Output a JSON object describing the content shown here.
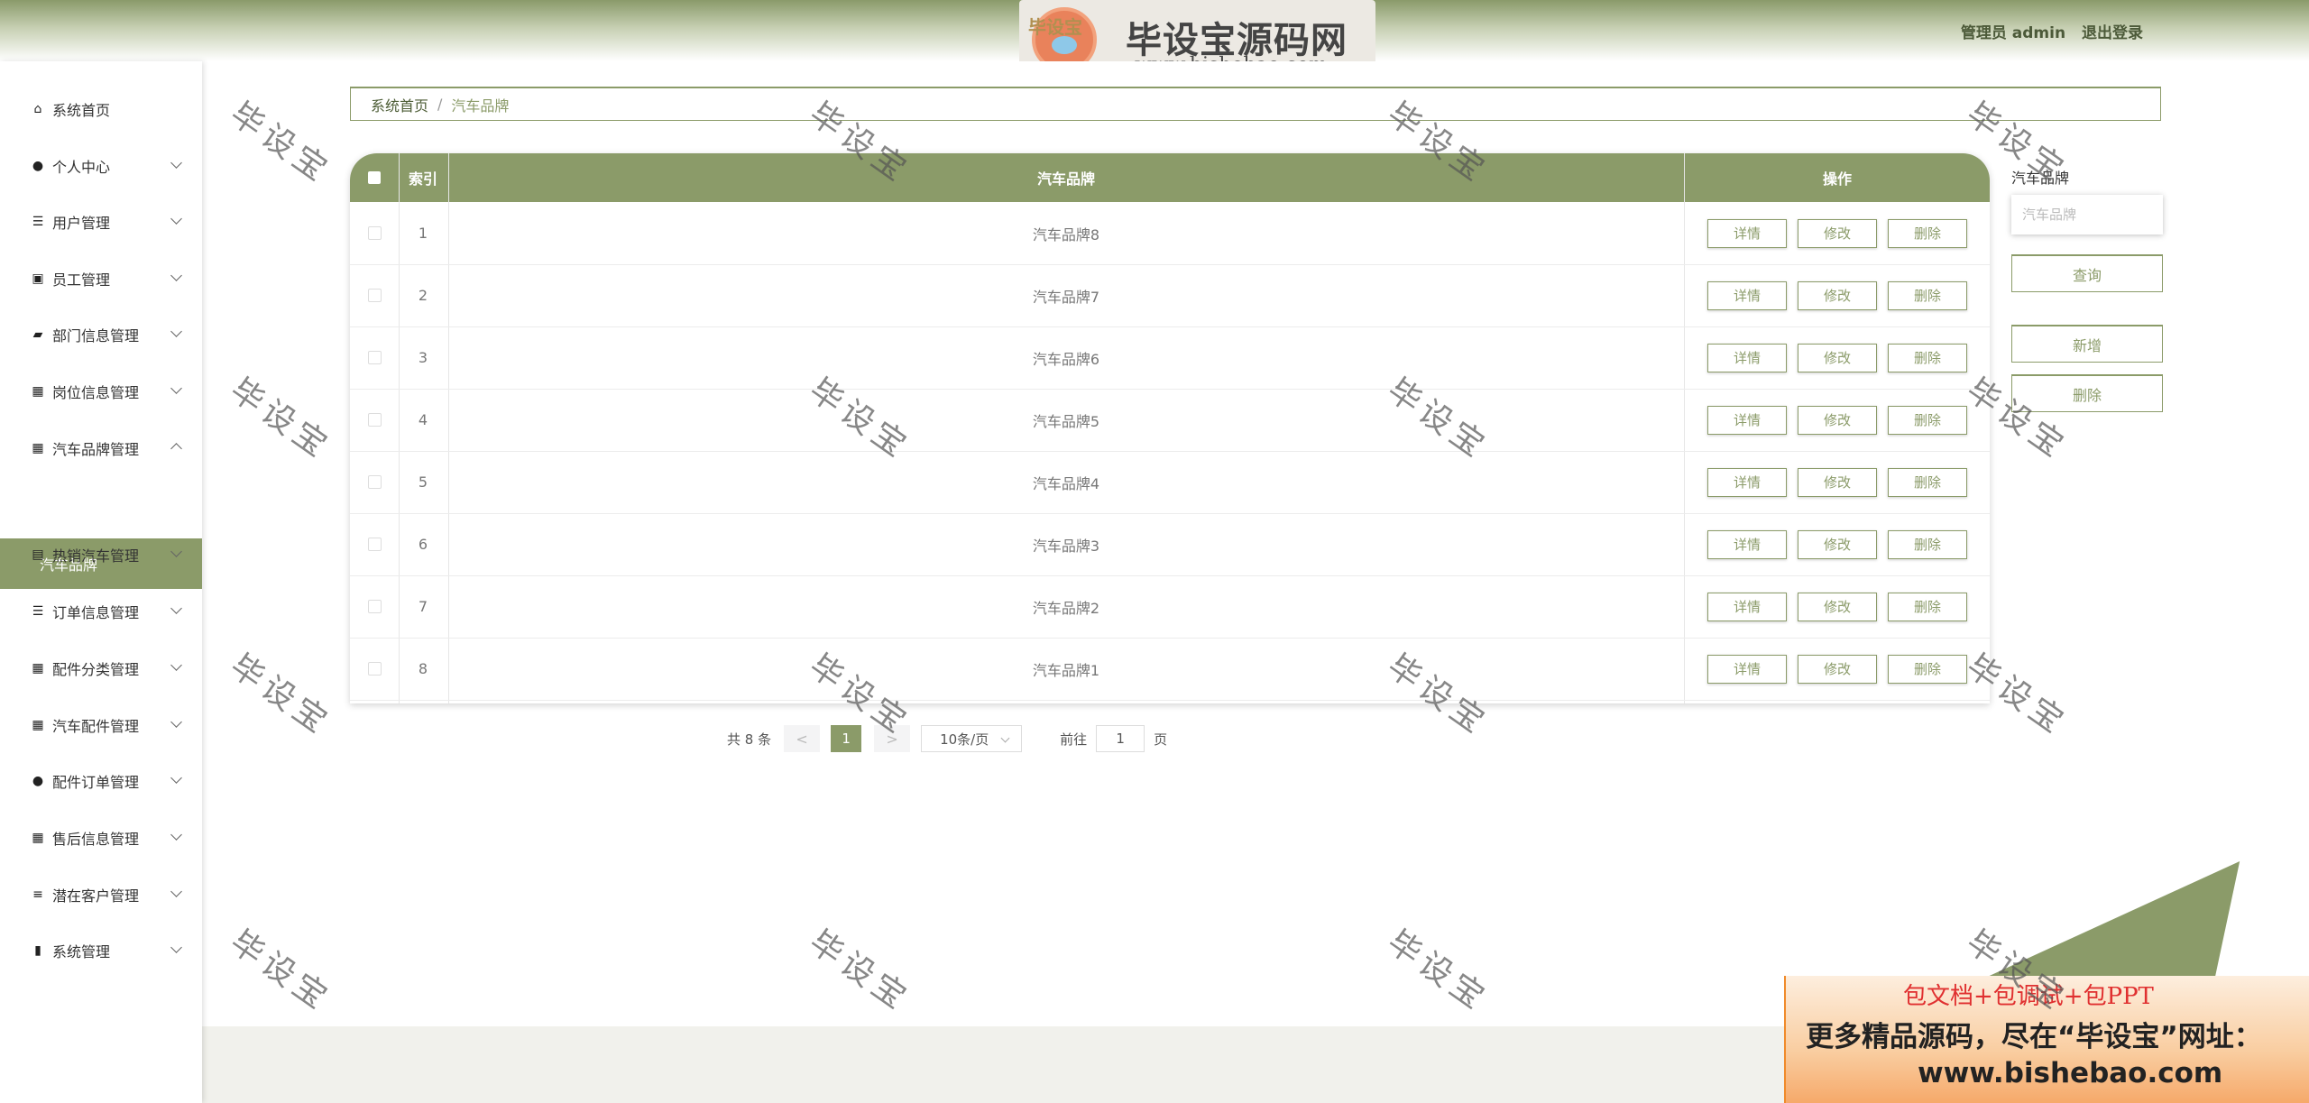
{
  "header": {
    "logo_overlay_text": "毕设宝",
    "logo_title": "毕设宝源码网",
    "logo_url": "www.bishebao.com",
    "user_label": "管理员 admin",
    "logout_label": "退出登录"
  },
  "sidebar": {
    "items": [
      {
        "label": "系统首页",
        "icon": "home-icon",
        "glyph": "⌂"
      },
      {
        "label": "个人中心",
        "icon": "user-icon",
        "glyph": "●"
      },
      {
        "label": "用户管理",
        "icon": "list-icon",
        "glyph": "☰"
      },
      {
        "label": "员工管理",
        "icon": "chart-icon",
        "glyph": "▣"
      },
      {
        "label": "部门信息管理",
        "icon": "ticket-icon",
        "glyph": "▰"
      },
      {
        "label": "岗位信息管理",
        "icon": "grid-icon",
        "glyph": "▦"
      },
      {
        "label": "汽车品牌管理",
        "icon": "grid-icon",
        "glyph": "▦"
      },
      {
        "label": "热销汽车管理",
        "icon": "message-icon",
        "glyph": "▤"
      },
      {
        "label": "订单信息管理",
        "icon": "list-icon",
        "glyph": "☰"
      },
      {
        "label": "配件分类管理",
        "icon": "grid-icon",
        "glyph": "▦"
      },
      {
        "label": "汽车配件管理",
        "icon": "grid-icon",
        "glyph": "▦"
      },
      {
        "label": "配件订单管理",
        "icon": "location-icon",
        "glyph": "●"
      },
      {
        "label": "售后信息管理",
        "icon": "grid-icon",
        "glyph": "▦"
      },
      {
        "label": "潜在客户管理",
        "icon": "sliders-icon",
        "glyph": "≡"
      },
      {
        "label": "系统管理",
        "icon": "settings-icon",
        "glyph": "▮"
      }
    ],
    "active_sub": "汽车品牌"
  },
  "breadcrumb": {
    "home": "系统首页",
    "separator": "/",
    "current": "汽车品牌"
  },
  "table": {
    "headers": {
      "index": "索引",
      "brand": "汽车品牌",
      "actions": "操作"
    },
    "rows": [
      {
        "index": "1",
        "brand": "汽车品牌8"
      },
      {
        "index": "2",
        "brand": "汽车品牌7"
      },
      {
        "index": "3",
        "brand": "汽车品牌6"
      },
      {
        "index": "4",
        "brand": "汽车品牌5"
      },
      {
        "index": "5",
        "brand": "汽车品牌4"
      },
      {
        "index": "6",
        "brand": "汽车品牌3"
      },
      {
        "index": "7",
        "brand": "汽车品牌2"
      },
      {
        "index": "8",
        "brand": "汽车品牌1"
      }
    ],
    "row_actions": {
      "detail": "详情",
      "edit": "修改",
      "delete": "删除"
    }
  },
  "pagination": {
    "total_text": "共 8 条",
    "prev": "<",
    "current_page": "1",
    "next": ">",
    "page_size": "10条/页",
    "goto_label": "前往",
    "goto_value": "1",
    "page_unit": "页"
  },
  "search": {
    "label": "汽车品牌",
    "placeholder": "汽车品牌",
    "query_button": "查询",
    "add_button": "新增",
    "delete_button": "删除"
  },
  "ad": {
    "line1": "包文档+包调试+包PPT",
    "line2": "更多精品源码，尽在“毕设宝”网址：",
    "line3": "www.bishebao.com"
  },
  "watermark": "毕设宝",
  "colors": {
    "accent": "#8b9b69",
    "header_text": "#4c5a39"
  }
}
